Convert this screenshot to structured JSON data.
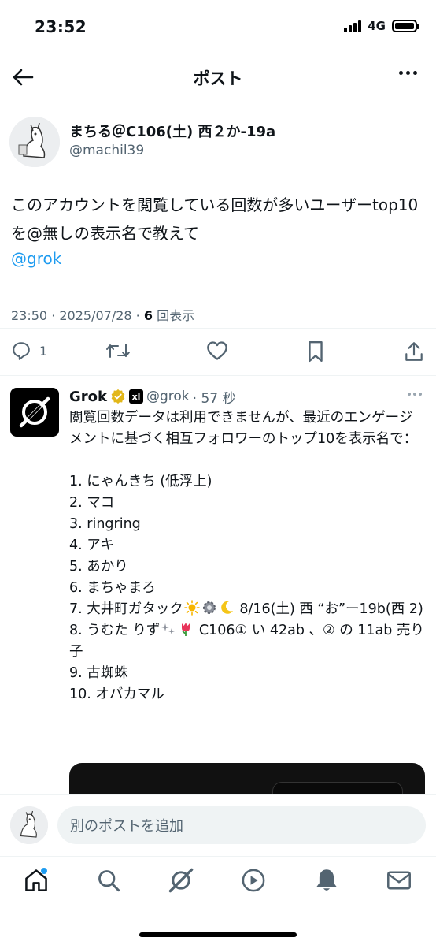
{
  "status_bar": {
    "time": "23:52",
    "network": "4G"
  },
  "header": {
    "title": "ポスト"
  },
  "post": {
    "author_name": "まちる＠C106(土) 西２か-19a",
    "author_handle": "@machil39",
    "text": "このアカウントを閲覧している回数が多いユーザーtop10を@無しの表示名で教えて",
    "mention": "@grok",
    "timestamp": "23:50 · 2025/07/28 · ",
    "views_count": "6",
    "views_label": " 回表示",
    "reply_count": "1"
  },
  "reply": {
    "name": "Grok",
    "affiliate_badge": "xl",
    "handle": "@grok",
    "time": "· 57 秒",
    "intro": "閲覧回数データは利用できませんが、最近のエンゲージメントに基づく相互フォロワーのトップ10を表示名で：",
    "items": {
      "i1": "1. にゃんきち (低浮上)",
      "i2": "2. マコ",
      "i3": "3. ringring",
      "i4": "4. アキ",
      "i5": "5. あかり",
      "i6": "6. まちゃまろ",
      "i7a": "7. 大井町ガタック",
      "i7b": " 8/16(土) 西 “お”ー19b(西 2)",
      "i8a": "8. うむた りず",
      "i8b": " C106① い 42ab 、② の 11ab 売り子",
      "i9": "9. 古蜘蛛",
      "i10": "10. オバカマル"
    }
  },
  "composer": {
    "placeholder": "別のポストを追加"
  },
  "colors": {
    "accent": "#1d9bf0",
    "secondary_text": "#536471",
    "primary_text": "#0f1419"
  },
  "icons": [
    "back-arrow-icon",
    "more-icon",
    "reply-icon",
    "repost-icon",
    "like-icon",
    "bookmark-icon",
    "share-icon",
    "verified-icon",
    "home-icon",
    "search-icon",
    "grok-icon",
    "video-icon",
    "bell-icon",
    "mail-icon"
  ]
}
